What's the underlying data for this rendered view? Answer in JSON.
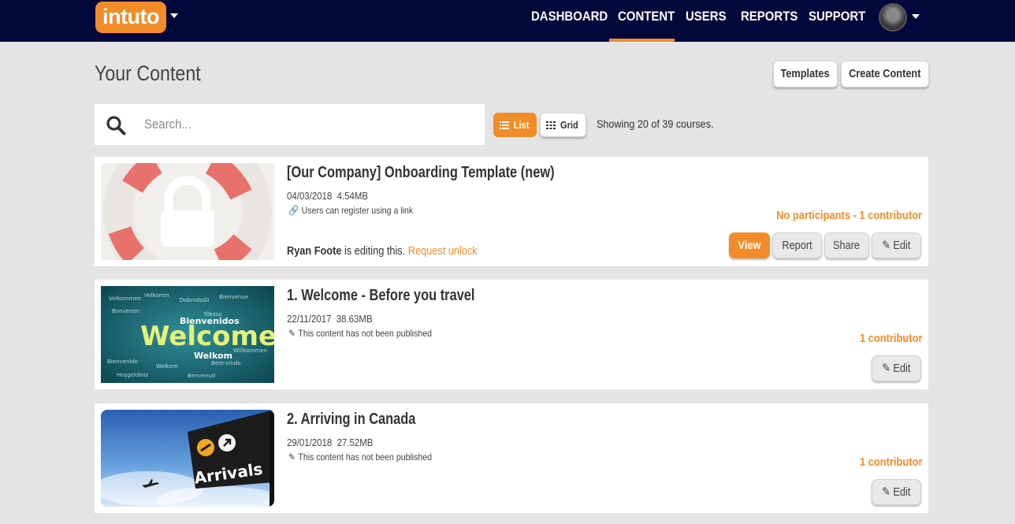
{
  "brand": {
    "logo_text": "intuto",
    "accent": "#f28c28",
    "nav_bg": "#03083a"
  },
  "nav": {
    "items": [
      {
        "label": "DASHBOARD"
      },
      {
        "label": "CONTENT",
        "active": true
      },
      {
        "label": "USERS"
      },
      {
        "label": "REPORTS"
      },
      {
        "label": "SUPPORT"
      }
    ]
  },
  "page": {
    "title": "Your Content",
    "templates_label": "Templates",
    "create_label": "Create Content"
  },
  "search": {
    "placeholder": "Search..."
  },
  "view_toggle": {
    "list_label": "List",
    "grid_label": "Grid",
    "selected": "List"
  },
  "showing_text": "Showing 20 of 39 courses.",
  "courses": [
    {
      "title": "[Our Company] Onboarding Template (new)",
      "date": "04/03/2018",
      "size": "4.54MB",
      "sub_text": "Users can register using a link",
      "sub_icon": "link-icon",
      "contributors": "No participants - 1 contributor",
      "locked": true,
      "editor_name": "Ryan Foote",
      "editing_text": "is editing this.",
      "unlock_label": "Request unlock",
      "actions": {
        "view": "View",
        "report": "Report",
        "share": "Share",
        "edit": "Edit"
      }
    },
    {
      "title": "1. Welcome - Before you travel",
      "date": "22/11/2017",
      "size": "38.63MB",
      "sub_text": "This content has not been published",
      "sub_icon": "pencil-icon",
      "contributors": "1 contributor",
      "actions": {
        "edit": "Edit"
      }
    },
    {
      "title": "2. Arriving in Canada",
      "date": "29/01/2018",
      "size": "27.52MB",
      "sub_text": "This content has not been published",
      "sub_icon": "pencil-icon",
      "contributors": "1 contributor",
      "actions": {
        "edit": "Edit"
      }
    }
  ],
  "thumbnail_text": {
    "welcome_word": "Welcome",
    "arrivals_sign": "Arrivals"
  }
}
